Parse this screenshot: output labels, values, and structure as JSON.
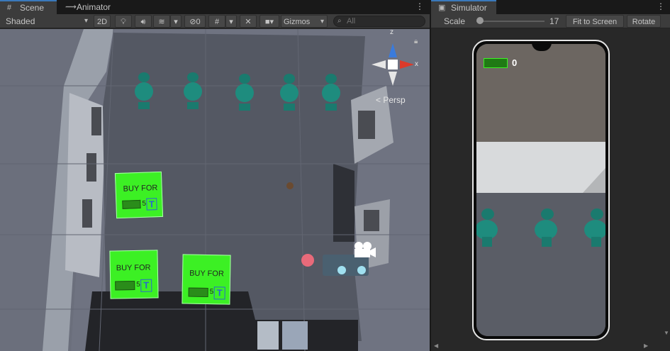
{
  "scene_tabs": [
    {
      "label": "Scene"
    },
    {
      "label": "Animator"
    }
  ],
  "scene_toolbar": {
    "shading_mode": "Shaded",
    "mode_2d": "2D",
    "hidden_count": "0",
    "gizmos": "Gizmos",
    "search_placeholder": "All"
  },
  "scene_view": {
    "persp_label": "Persp",
    "axis_x": "x",
    "axis_z": "z",
    "store_zones": [
      {
        "line1": "BUY FOR",
        "price": "5"
      },
      {
        "line1": "BUY FOR",
        "price": "5"
      },
      {
        "line1": "BUY FOR",
        "price": "5"
      }
    ]
  },
  "simulator": {
    "tab_label": "Simulator",
    "scale_label": "Scale",
    "scale_value": "17",
    "scale_fraction": 0.05,
    "fit_to_screen": "Fit to Screen",
    "rotate": "Rotate",
    "money_count": "0"
  },
  "colors": {
    "accent": "#3a79bb",
    "store_green": "#3cf024",
    "table_teal": "#1e8c7e",
    "floor": "#545863"
  }
}
